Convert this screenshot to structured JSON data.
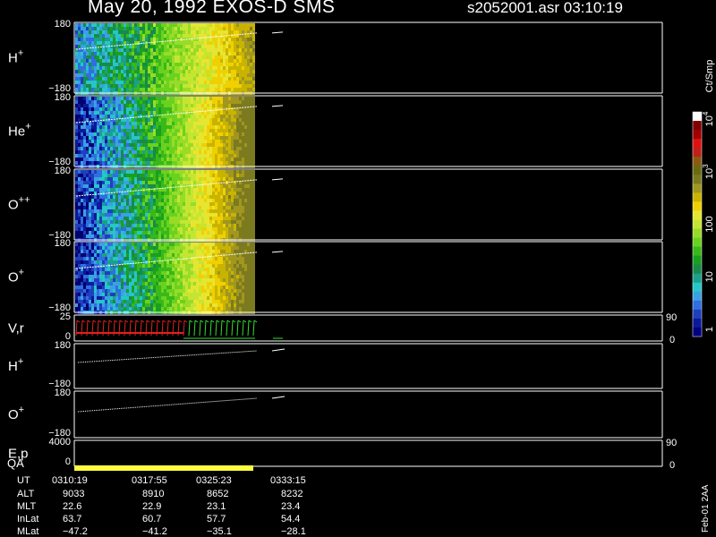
{
  "header": {
    "title": "May 20, 1992   EXOS-D SMS",
    "file_info": "s2052001.asr  03:10:19"
  },
  "panels": [
    {
      "name": "panel-h-plus",
      "label": "H",
      "sup": "+",
      "ymax": "180",
      "ymin": "−180"
    },
    {
      "name": "panel-he-plus",
      "label": "He",
      "sup": "+",
      "ymax": "180",
      "ymin": "−180"
    },
    {
      "name": "panel-o-plusplus",
      "label": "O",
      "sup": "++",
      "ymax": "180",
      "ymin": "−180"
    },
    {
      "name": "panel-o-plus",
      "label": "O",
      "sup": "+",
      "ymax": "180",
      "ymin": "−180"
    },
    {
      "name": "panel-vr",
      "label": "V,r",
      "sup": "",
      "ymax": "25",
      "ymin": "0",
      "right_max": "90",
      "right_min": "0"
    },
    {
      "name": "panel-h-plus-line",
      "label": "H",
      "sup": "+",
      "ymax": "180",
      "ymin": "−180"
    },
    {
      "name": "panel-o-plus-line",
      "label": "O",
      "sup": "+",
      "ymax": "180",
      "ymin": "−180"
    },
    {
      "name": "panel-ep",
      "label": "E,p",
      "sup": "",
      "ymax": "4000",
      "ymin": "0",
      "right_max": "90",
      "right_min": "0"
    }
  ],
  "qa_label": "QA",
  "colorbar": {
    "unit": "Ct/Smp",
    "ticks": [
      {
        "value": 1,
        "text": "1"
      },
      {
        "value": 10,
        "text": "10"
      },
      {
        "value": 100,
        "text": "100"
      },
      {
        "value": 1000,
        "text": "10",
        "sup": "3"
      },
      {
        "value": 10000,
        "text": "10",
        "sup": "4"
      }
    ],
    "colors": [
      "#000080",
      "#0a1a9a",
      "#1f3fbf",
      "#2f6fdf",
      "#3aa0e6",
      "#26c6c6",
      "#1aa08c",
      "#188a4a",
      "#1aa020",
      "#38b81a",
      "#6ad21e",
      "#98dc28",
      "#c4e632",
      "#e6e632",
      "#f0d000",
      "#c8b400",
      "#a09620",
      "#7c7a1e",
      "#6a6a10",
      "#8a5a10",
      "#c02018",
      "#e01010",
      "#a00000",
      "#800000",
      "#ffffff"
    ]
  },
  "side_stamp": "Feb-01 2AA",
  "chart_data": {
    "type": "heatmap",
    "x_range": [
      "03:10:19",
      "03:33:15"
    ],
    "data_coverage_end": "03:25:23",
    "y_range": [
      -180,
      180
    ],
    "color_scale": "log",
    "color_range": [
      1,
      10000
    ],
    "series": [
      {
        "name": "H+"
      },
      {
        "name": "He+"
      },
      {
        "name": "O++"
      },
      {
        "name": "O+"
      }
    ]
  },
  "table": {
    "row_labels": [
      "UT",
      "ALT",
      "MLT",
      "InLat",
      "MLat"
    ],
    "columns": [
      [
        "0310:19",
        "9033",
        "22.6",
        "63.7",
        "−47.2"
      ],
      [
        "0317:55",
        "8910",
        "22.9",
        "60.7",
        "−41.2"
      ],
      [
        "0325:23",
        "8652",
        "23.1",
        "57.7",
        "−35.1"
      ],
      [
        "0333:15",
        "8232",
        "23.4",
        "54.4",
        "−28.1"
      ]
    ]
  }
}
